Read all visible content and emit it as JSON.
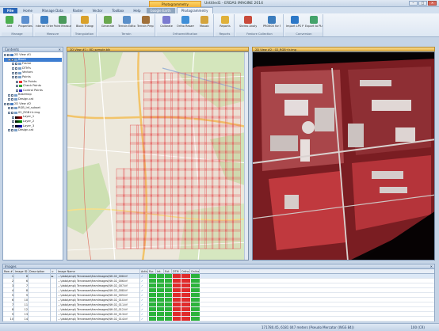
{
  "titlebar": {
    "context_tab": "Photogrammetry",
    "title": "Untitled1 - ERDAS IMAGINE 2014",
    "min": "–",
    "max": "□",
    "close": "✕"
  },
  "ribbon_tabs": [
    "File",
    "Home",
    "Manage Data",
    "Raster",
    "Vector",
    "Toolbox",
    "Help",
    "Google Earth",
    "Photogrammetry"
  ],
  "ribbon": {
    "groups": [
      {
        "label": "Manage",
        "buttons": [
          {
            "label": "Add",
            "icon": "plus-icon",
            "color": "#4caf50"
          },
          {
            "label": "Properties",
            "icon": "properties-icon",
            "color": "#5c8fcf"
          }
        ]
      },
      {
        "label": "Measure",
        "buttons": [
          {
            "label": "Interior Orientation",
            "icon": "interior-icon",
            "color": "#3d7fc4"
          },
          {
            "label": "Point Measurement",
            "icon": "point-icon",
            "color": "#4b9a5c"
          }
        ]
      },
      {
        "label": "Triangulation",
        "buttons": [
          {
            "label": "Block Triangulation",
            "icon": "triangulation-icon",
            "color": "#d9a12b"
          }
        ]
      },
      {
        "label": "Terrain",
        "buttons": [
          {
            "label": "Generate",
            "icon": "generate-icon",
            "color": "#6aa84f"
          },
          {
            "label": "Terrain Editor (TE)",
            "icon": "terrain-editor-icon",
            "color": "#5a8fc9"
          },
          {
            "label": "Terrain Prep Tool (TPT)",
            "icon": "terrain-prep-icon",
            "color": "#a0703a"
          }
        ]
      },
      {
        "label": "Orthorectification",
        "buttons": [
          {
            "label": "Calibrate",
            "icon": "calibrate-icon",
            "color": "#7b7bd0"
          },
          {
            "label": "Ortho Resample",
            "icon": "ortho-icon",
            "color": "#3f8fd8"
          },
          {
            "label": "Mosaic",
            "icon": "mosaic-icon",
            "color": "#d4a43d"
          }
        ]
      },
      {
        "label": "Reports",
        "buttons": [
          {
            "label": "Reports",
            "icon": "reports-icon",
            "color": "#e0b13a"
          }
        ]
      },
      {
        "label": "Feature Collection",
        "buttons": [
          {
            "label": "Stereo Analyst",
            "icon": "stereo-icon",
            "color": "#c94b3b"
          },
          {
            "label": "PRO600 for MAGINE",
            "icon": "pro600-icon",
            "color": "#3c7dbd"
          }
        ]
      },
      {
        "label": "Conversion",
        "buttons": [
          {
            "label": "Import LPS Project",
            "icon": "import-icon",
            "color": "#2c78c8"
          },
          {
            "label": "Export to PLCS Project",
            "icon": "export-icon",
            "color": "#44a36b"
          }
        ]
      }
    ]
  },
  "contents": {
    "title": "Contents",
    "tree": [
      {
        "indent": 0,
        "label": "2D View #1",
        "kind": "group"
      },
      {
        "indent": 1,
        "label": "Block",
        "kind": "item",
        "selected": true
      },
      {
        "indent": 2,
        "label": "Frame",
        "kind": "item"
      },
      {
        "indent": 2,
        "label": "DTM's",
        "kind": "item"
      },
      {
        "indent": 2,
        "label": "Vectors",
        "kind": "item"
      },
      {
        "indent": 2,
        "label": "Points",
        "kind": "item"
      },
      {
        "indent": 3,
        "label": "Tie Points",
        "kind": "swatch",
        "color": "#e33"
      },
      {
        "indent": 3,
        "label": "Check Points",
        "kind": "swatch",
        "color": "#3a3"
      },
      {
        "indent": 3,
        "label": "Control Points",
        "kind": "swatch",
        "color": "#33c"
      },
      {
        "indent": 1,
        "label": "Basemap",
        "kind": "item"
      },
      {
        "indent": 1,
        "label": "Design.cat",
        "kind": "item"
      },
      {
        "indent": 0,
        "label": "2D View #2",
        "kind": "group"
      },
      {
        "indent": 1,
        "label": "RGB_Inf_subset",
        "kind": "item"
      },
      {
        "indent": 1,
        "label": "02_RGB+Ir.img",
        "kind": "item"
      },
      {
        "indent": 2,
        "label": "Layer_1",
        "kind": "grad",
        "color": "#c00"
      },
      {
        "indent": 2,
        "label": "Layer_2",
        "kind": "grad",
        "color": "#0a0"
      },
      {
        "indent": 2,
        "label": "Layer_3",
        "kind": "grad",
        "color": "#00c"
      },
      {
        "indent": 1,
        "label": "Design.cat",
        "kind": "item"
      }
    ]
  },
  "views": {
    "left_tab": "2D View #1 : 8D_sample.blk",
    "right_tab": "2D View #2 : 02_RGB+Ir.img"
  },
  "images_panel": {
    "title": "Images",
    "columns": [
      "Row #",
      "Image ID",
      "Description",
      ">",
      "Image Name",
      "Active",
      "Pyr.",
      "Int.",
      "Ext.",
      "DTM",
      "Ortho",
      "Online"
    ],
    "rows": [
      {
        "row": "1",
        "id": "8",
        "name": "…\\data\\ampl\\ Tennessee\\framImages\\NH-02_008.tif"
      },
      {
        "row": "2",
        "id": "6",
        "name": "…\\data\\ampl\\ Tennessee\\framImages\\NH-02_006.tif"
      },
      {
        "row": "3",
        "id": "7",
        "name": "…\\data\\ampl\\ Tennessee\\framImages\\NH-02_007.tif"
      },
      {
        "row": "4",
        "id": "8",
        "name": "…\\data\\ampl\\ Tennessee\\framImages\\NH-02_008.tif"
      },
      {
        "row": "5",
        "id": "9",
        "name": "…\\data\\ampl\\ Tennessee\\framImages\\NH-02_009.tif"
      },
      {
        "row": "6",
        "id": "10",
        "name": "…\\data\\ampl\\ Tennessee\\framImages\\NH-02_010.tif"
      },
      {
        "row": "7",
        "id": "11",
        "name": "…\\data\\ampl\\ Tennessee\\framImages\\NH-02_011.tif"
      },
      {
        "row": "8",
        "id": "12",
        "name": "…\\data\\ampl\\ Tennessee\\framImages\\NH-02_012.tif"
      },
      {
        "row": "9",
        "id": "13",
        "name": "…\\data\\ampl\\ Tennessee\\framImages\\NH-02_013.tif"
      },
      {
        "row": "10",
        "id": "14",
        "name": "…\\data\\ampl\\ Tennessee\\framImages\\NH-02_014.tif"
      }
    ],
    "flag_colors": {
      "green": "#2bb33b",
      "red": "#e02b2b"
    }
  },
  "status": {
    "coords": "171780.45, 6181 047 meters (Pseudo Mercator (WGS 84))",
    "zoom": "100 (CR)"
  }
}
